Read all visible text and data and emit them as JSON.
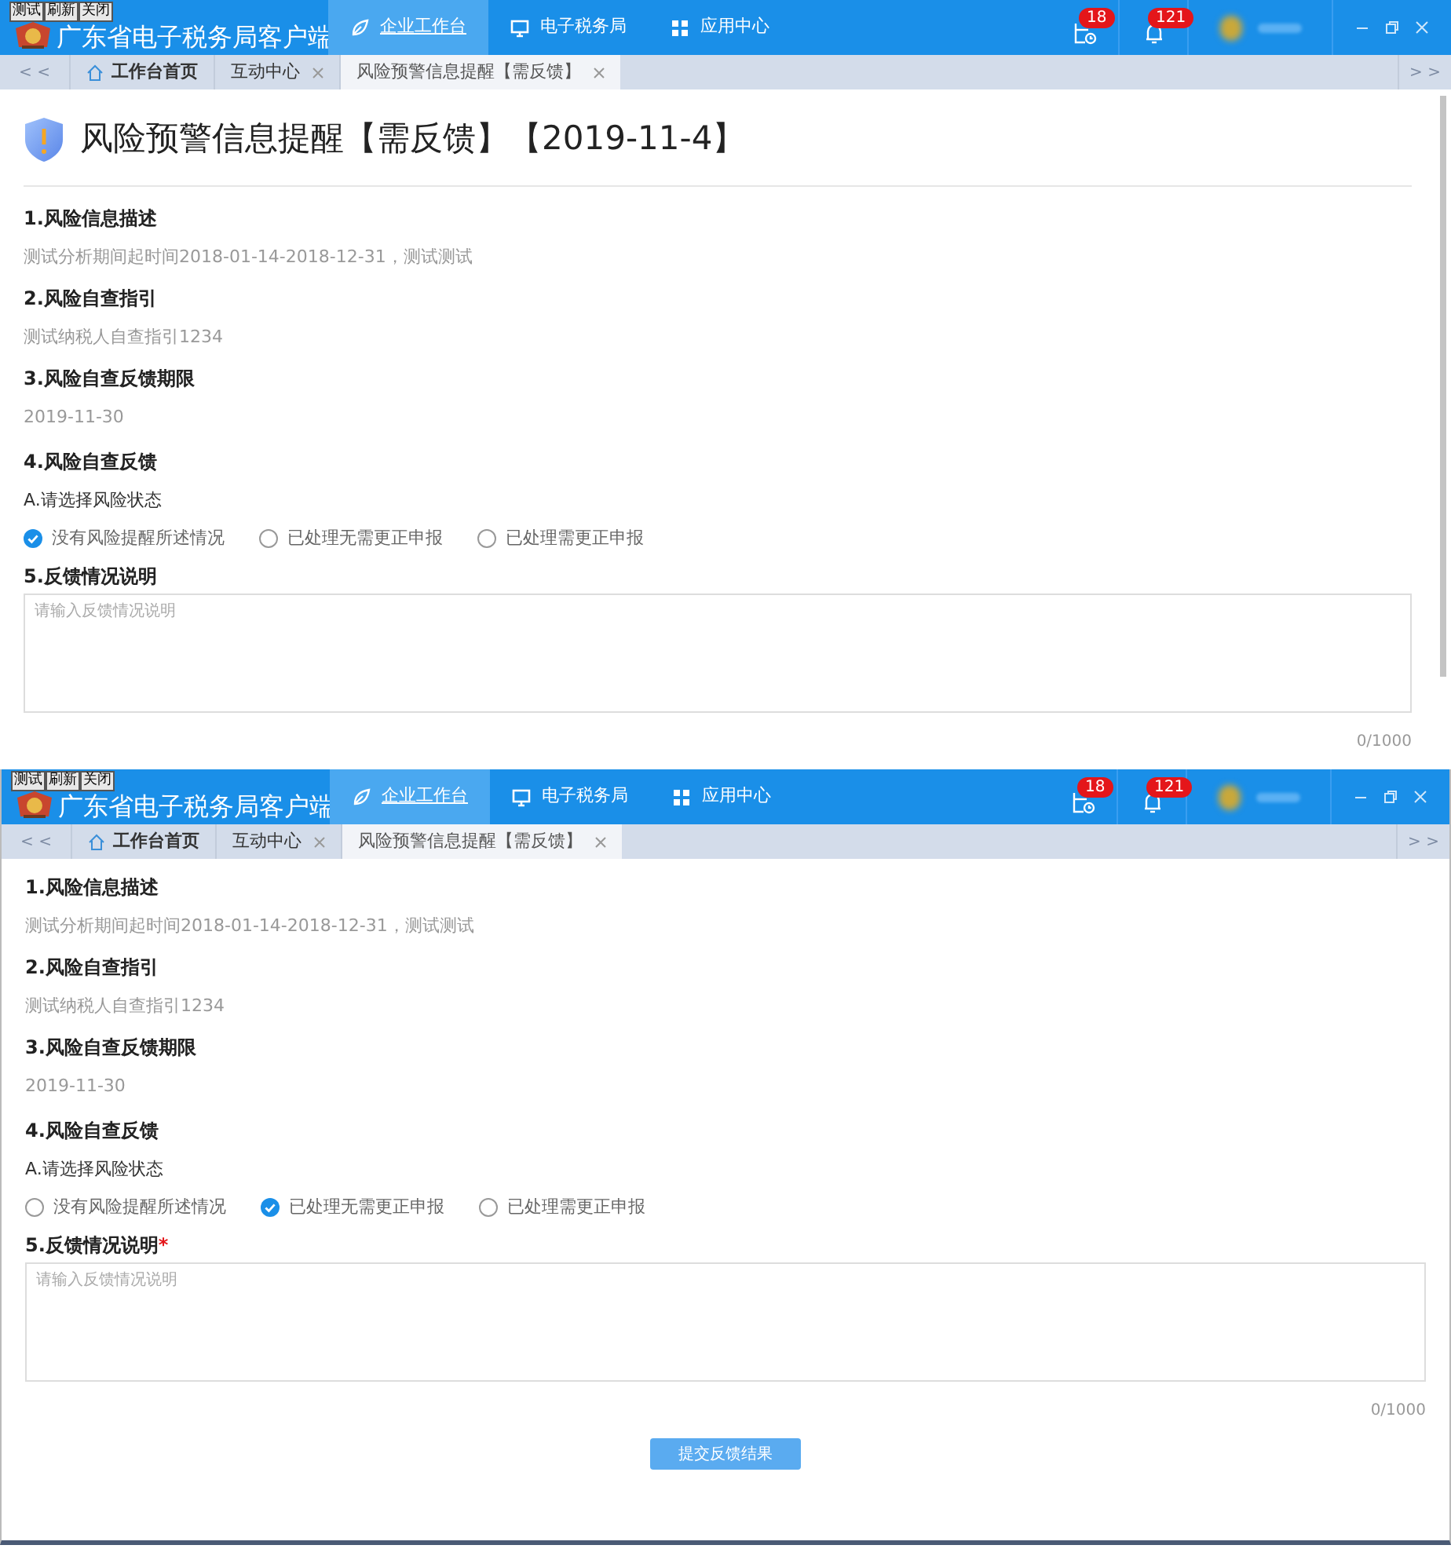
{
  "screenshots": [
    {
      "debug_buttons": [
        "测试",
        "刷新",
        "关闭"
      ],
      "app_title": "广东省电子税务局客户端",
      "nav": [
        {
          "label": "企业工作台",
          "selected": true
        },
        {
          "label": "电子税务局",
          "selected": false
        },
        {
          "label": "应用中心",
          "selected": false
        }
      ],
      "badges": [
        {
          "count": "18"
        },
        {
          "count": "121"
        }
      ],
      "scroll_left": "< <",
      "scroll_right": "> >",
      "tabs": [
        {
          "label": "工作台首页",
          "home": true,
          "closable": false,
          "selected": false
        },
        {
          "label": "互动中心",
          "home": false,
          "closable": true,
          "selected": false
        },
        {
          "label": "风险预警信息提醒【需反馈】",
          "home": false,
          "closable": true,
          "selected": true
        }
      ],
      "page_title": "风险预警信息提醒【需反馈】【2019-11-4】",
      "sections": [
        {
          "kind": "text",
          "heading": "1.风险信息描述",
          "text": "测试分析期间起时间2018-01-14-2018-12-31，测试测试"
        },
        {
          "kind": "text",
          "heading": "2.风险自查指引",
          "text": "测试纳税人自查指引1234"
        },
        {
          "kind": "text",
          "heading": "3.风险自查反馈期限",
          "text": "2019-11-30"
        },
        {
          "kind": "radio",
          "heading": "4.风险自查反馈",
          "prompt": "A.请选择风险状态",
          "options": [
            {
              "label": "没有风险提醒所述情况",
              "selected": true
            },
            {
              "label": "已处理无需更正申报",
              "selected": false
            },
            {
              "label": "已处理需更正申报",
              "selected": false
            }
          ]
        },
        {
          "kind": "textarea",
          "heading": "5.反馈情况说明",
          "placeholder": "请输入反馈情况说明",
          "counter": "0/1000"
        }
      ]
    },
    {
      "debug_buttons": [
        "测试",
        "刷新",
        "关闭"
      ],
      "app_title": "广东省电子税务局客户端",
      "nav": [
        {
          "label": "企业工作台",
          "selected": true
        },
        {
          "label": "电子税务局",
          "selected": false
        },
        {
          "label": "应用中心",
          "selected": false
        }
      ],
      "badges": [
        {
          "count": "18"
        },
        {
          "count": "121"
        }
      ],
      "scroll_left": "< <",
      "scroll_right": "> >",
      "tabs": [
        {
          "label": "工作台首页",
          "home": true,
          "closable": false,
          "selected": false
        },
        {
          "label": "互动中心",
          "home": false,
          "closable": true,
          "selected": false
        },
        {
          "label": "风险预警信息提醒【需反馈】",
          "home": false,
          "closable": true,
          "selected": true
        }
      ],
      "sections": [
        {
          "kind": "text",
          "heading": "1.风险信息描述",
          "text": "测试分析期间起时间2018-01-14-2018-12-31，测试测试"
        },
        {
          "kind": "text",
          "heading": "2.风险自查指引",
          "text": "测试纳税人自查指引1234"
        },
        {
          "kind": "text",
          "heading": "3.风险自查反馈期限",
          "text": "2019-11-30"
        },
        {
          "kind": "radio",
          "heading": "4.风险自查反馈",
          "prompt": "A.请选择风险状态",
          "options": [
            {
              "label": "没有风险提醒所述情况",
              "selected": false
            },
            {
              "label": "已处理无需更正申报",
              "selected": true
            },
            {
              "label": "已处理需更正申报",
              "selected": false
            }
          ]
        },
        {
          "kind": "textarea",
          "heading": "5.反馈情况说明",
          "required_mark": "*",
          "placeholder": "请输入反馈情况说明",
          "counter": "0/1000"
        }
      ],
      "submit_button": "提交反馈结果"
    }
  ]
}
